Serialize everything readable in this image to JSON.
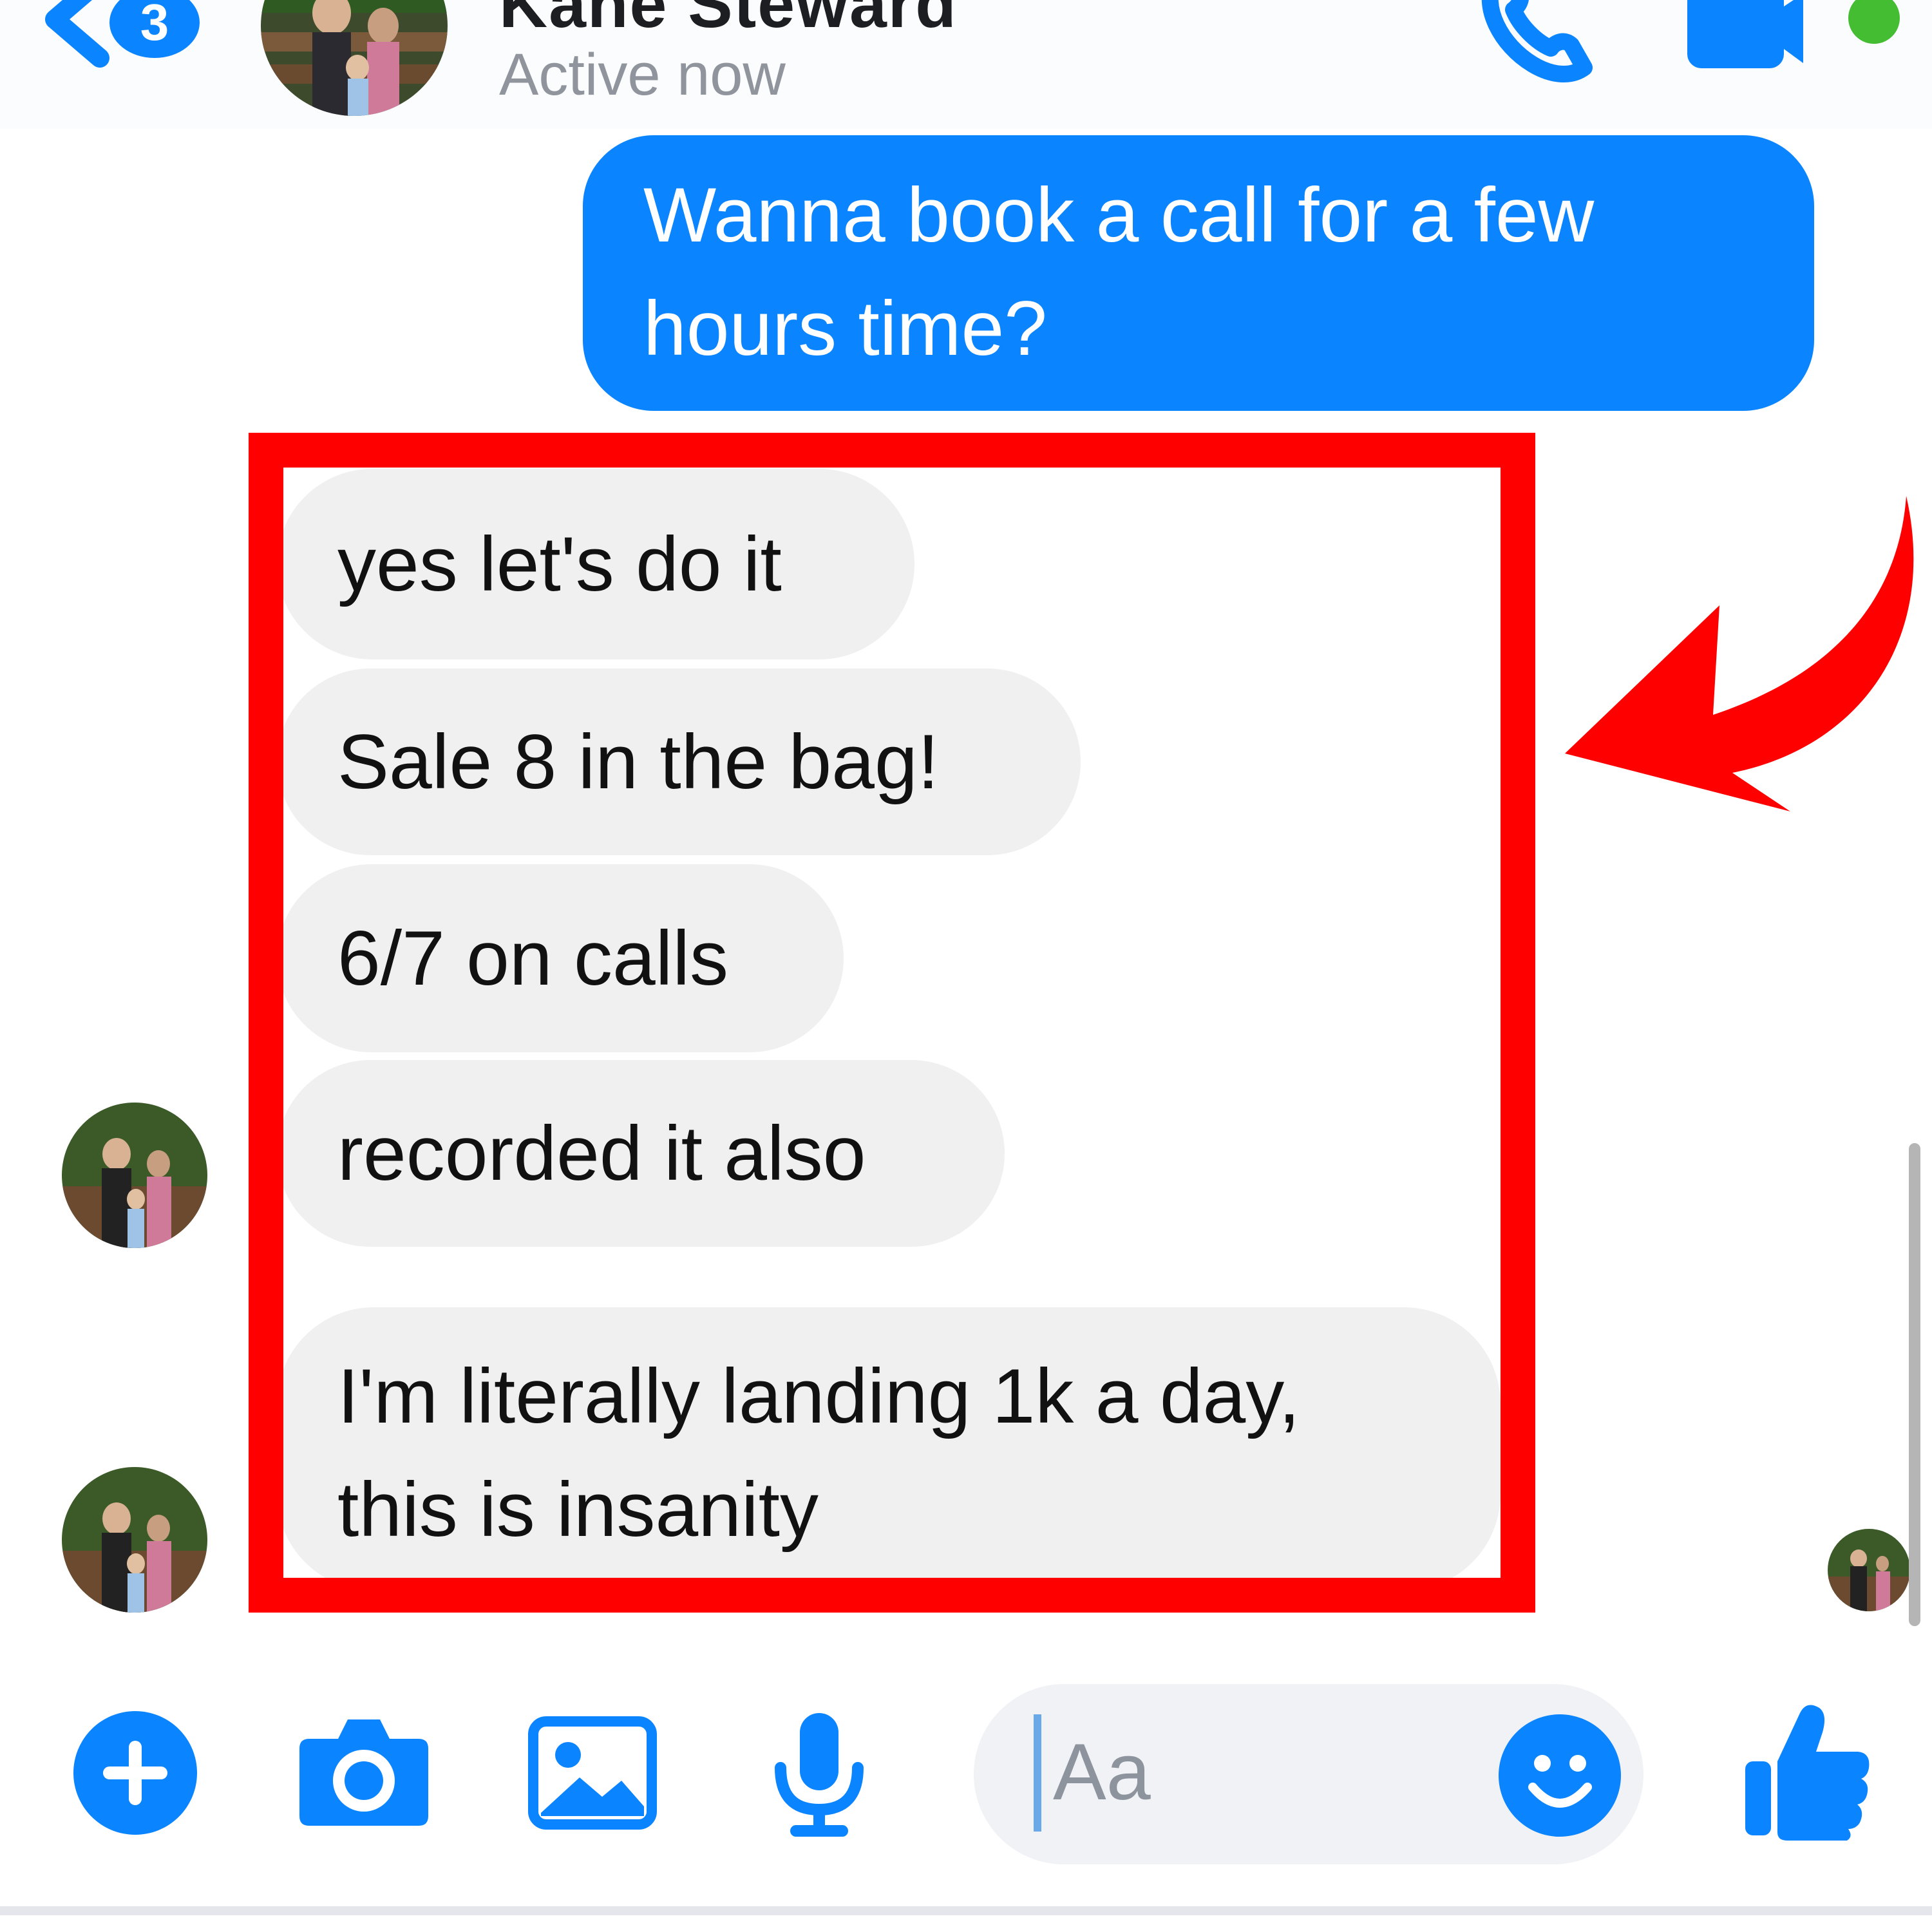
{
  "header": {
    "back_badge_count": "3",
    "contact_name": "Kane Steward",
    "status": "Active now"
  },
  "messages": {
    "sent": "Wanna book a call for a few hours time?",
    "received": [
      "yes let's do it",
      "Sale 8 in the bag!",
      "6/7 on calls",
      "recorded it also",
      "I'm literally landing 1k a day, this is insanity"
    ]
  },
  "composer": {
    "placeholder": "Aa"
  },
  "colors": {
    "messenger_blue": "#0b84ff",
    "received_bubble": "#f1f0f0",
    "highlight_red": "#ff0000",
    "online_green": "#44bd32"
  },
  "icons": [
    "back-icon",
    "phone-icon",
    "video-call-icon",
    "online-dot-icon",
    "plus-icon",
    "camera-icon",
    "image-icon",
    "microphone-icon",
    "emoji-icon",
    "like-icon",
    "curved-arrow-icon"
  ]
}
